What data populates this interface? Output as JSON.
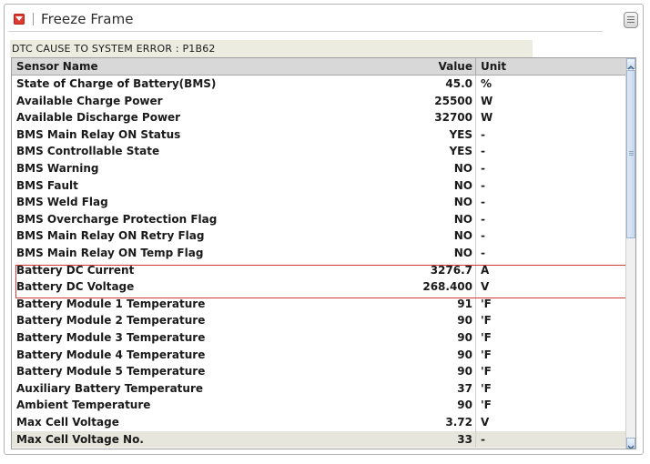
{
  "window": {
    "title": "Freeze Frame",
    "menu_icon": "menu-icon",
    "close_icon": "collapse-icon"
  },
  "dtc": {
    "text": "DTC CAUSE TO SYSTEM ERROR : P1B62"
  },
  "table": {
    "headers": {
      "name": "Sensor Name",
      "value": "Value",
      "unit": "Unit"
    },
    "rows": [
      {
        "name": "State of Charge of Battery(BMS)",
        "value": "45.0",
        "unit": "%"
      },
      {
        "name": "Available Charge Power",
        "value": "25500",
        "unit": "W"
      },
      {
        "name": "Available Discharge Power",
        "value": "32700",
        "unit": "W"
      },
      {
        "name": "BMS Main Relay ON Status",
        "value": "YES",
        "unit": "-"
      },
      {
        "name": "BMS Controllable State",
        "value": "YES",
        "unit": "-"
      },
      {
        "name": "BMS Warning",
        "value": "NO",
        "unit": "-"
      },
      {
        "name": "BMS Fault",
        "value": "NO",
        "unit": "-"
      },
      {
        "name": "BMS Weld Flag",
        "value": "NO",
        "unit": "-"
      },
      {
        "name": "BMS Overcharge Protection Flag",
        "value": "NO",
        "unit": "-"
      },
      {
        "name": "BMS Main Relay ON Retry Flag",
        "value": "NO",
        "unit": "-"
      },
      {
        "name": "BMS Main Relay ON Temp Flag",
        "value": "NO",
        "unit": "-"
      },
      {
        "name": "Battery DC Current",
        "value": "3276.7",
        "unit": "A"
      },
      {
        "name": "Battery DC Voltage",
        "value": "268.400",
        "unit": "V"
      },
      {
        "name": "Battery Module 1 Temperature",
        "value": "91",
        "unit": "'F"
      },
      {
        "name": "Battery Module 2 Temperature",
        "value": "90",
        "unit": "'F"
      },
      {
        "name": "Battery Module 3 Temperature",
        "value": "90",
        "unit": "'F"
      },
      {
        "name": "Battery Module 4 Temperature",
        "value": "90",
        "unit": "'F"
      },
      {
        "name": "Battery Module 5 Temperature",
        "value": "90",
        "unit": "'F"
      },
      {
        "name": "Auxiliary Battery Temperature",
        "value": "37",
        "unit": "'F"
      },
      {
        "name": "Ambient Temperature",
        "value": "90",
        "unit": "'F"
      },
      {
        "name": "Max Cell Voltage",
        "value": "3.72",
        "unit": "V"
      },
      {
        "name": "Max Cell Voltage No.",
        "value": "33",
        "unit": "-"
      }
    ],
    "highlighted_rows": [
      "Battery DC Current",
      "Battery DC Voltage"
    ],
    "highlight_color": "#d23a3a"
  },
  "colors": {
    "accent": "#e03a2e",
    "dtc_bg": "#ecece1",
    "header_bg": "#d8d8d8",
    "alt_row_bg": "#e6e6dc"
  }
}
